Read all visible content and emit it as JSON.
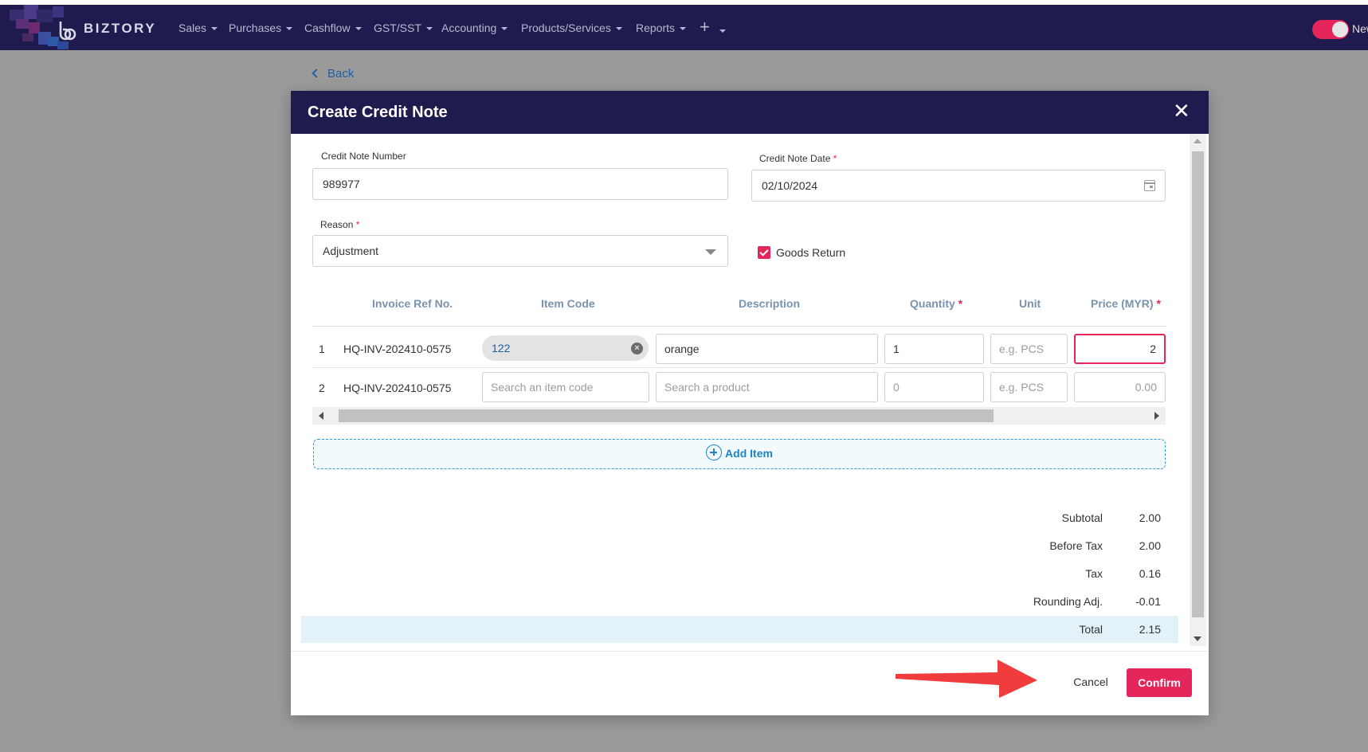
{
  "nav": {
    "brand": "BIZTORY",
    "items": [
      "Sales",
      "Purchases",
      "Cashflow",
      "GST/SST",
      "Accounting",
      "Products/Services",
      "Reports"
    ],
    "plus": "+",
    "right_label": "New",
    "toggle_on": true
  },
  "back_label": "Back",
  "modal": {
    "title": "Create Credit Note",
    "close": "✕",
    "credit_note_number": {
      "label": "Credit Note Number",
      "value": "989977"
    },
    "credit_note_date": {
      "label": "Credit Note Date",
      "required": "*",
      "value": "02/10/2024"
    },
    "reason": {
      "label": "Reason",
      "required": "*",
      "value": "Adjustment"
    },
    "goods_return": {
      "label": "Goods Return",
      "checked": true
    },
    "table": {
      "headers": [
        "Invoice Ref No.",
        "Item Code",
        "Description",
        "Quantity",
        "Unit",
        "Price (MYR)"
      ],
      "required_marker": "*",
      "rows": [
        {
          "num": "1",
          "ref": "HQ-INV-202410-0575",
          "item_code": "122",
          "description": "orange",
          "quantity": "1",
          "unit_placeholder": "e.g. PCS",
          "price": "2"
        },
        {
          "num": "2",
          "ref": "HQ-INV-202410-0575",
          "item_code_placeholder": "Search an item code",
          "description_placeholder": "Search a product",
          "quantity_placeholder": "0",
          "unit_placeholder": "e.g. PCS",
          "price_placeholder": "0.00"
        }
      ]
    },
    "add_item": "Add Item",
    "summary": [
      {
        "label": "Subtotal",
        "value": "2.00"
      },
      {
        "label": "Before Tax",
        "value": "2.00"
      },
      {
        "label": "Tax",
        "value": "0.16"
      },
      {
        "label": "Rounding Adj.",
        "value": "-0.01"
      },
      {
        "label": "Total",
        "value": "2.15"
      }
    ],
    "cancel": "Cancel",
    "confirm": "Confirm"
  },
  "colors": {
    "navbar": "#1f1b4e",
    "accent": "#e5265a",
    "link": "#1f5fa3",
    "add_item": "#1c84c6",
    "overlay": "#9a9a9a"
  }
}
